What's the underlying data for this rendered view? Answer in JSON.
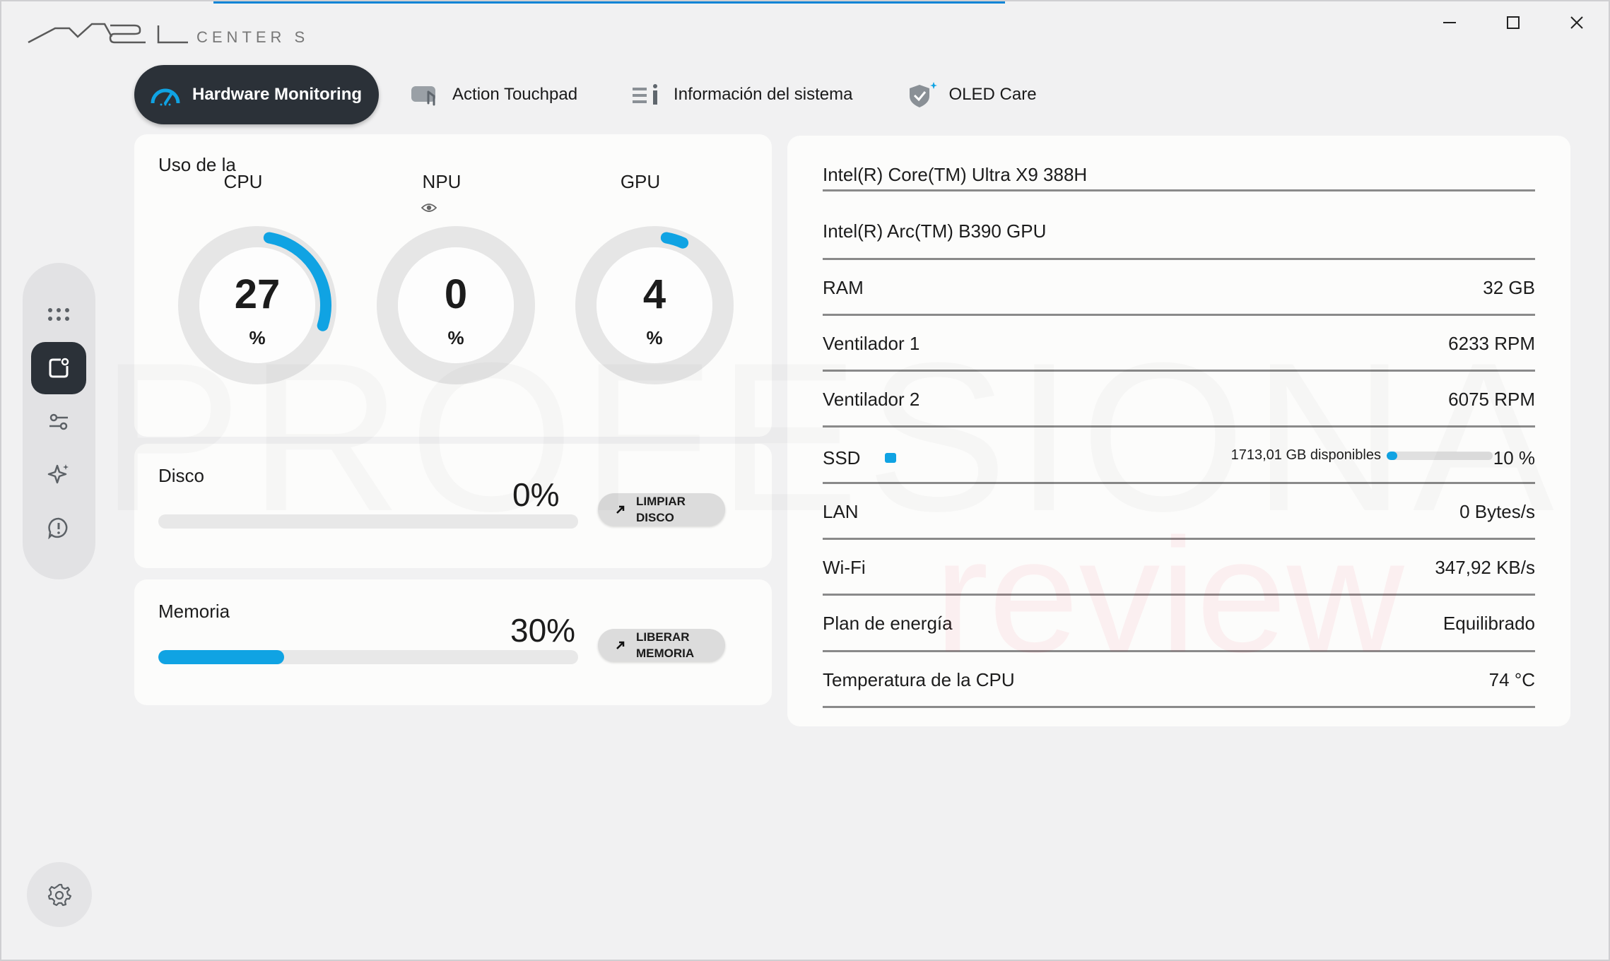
{
  "app": {
    "name": "MSI Center S",
    "accent": "#10a3e3",
    "dark": "#2b3138"
  },
  "window_controls": [
    "minimize-icon",
    "maximize-icon",
    "close-icon"
  ],
  "tabs": [
    {
      "label": "Hardware Monitoring",
      "icon": "speedometer-icon",
      "active": true
    },
    {
      "label": "Action Touchpad",
      "icon": "touchpad-icon",
      "active": false
    },
    {
      "label": "Información del sistema",
      "icon": "system-info-icon",
      "active": false
    },
    {
      "label": "OLED Care",
      "icon": "shield-sparkle-icon",
      "active": false
    }
  ],
  "sidebar": {
    "items": [
      {
        "icon": "apps-grid-icon",
        "active": false
      },
      {
        "icon": "feature-box-icon",
        "active": true
      },
      {
        "icon": "sliders-icon",
        "active": false
      },
      {
        "icon": "sparkle-star-icon",
        "active": false
      },
      {
        "icon": "support-chat-icon",
        "active": false
      }
    ],
    "settings_icon": "gear-icon"
  },
  "usage": {
    "title": "Uso de la",
    "gauges": [
      {
        "label": "CPU",
        "value": "27",
        "unit": "%",
        "fraction": 0.27
      },
      {
        "label": "NPU",
        "value": "0",
        "unit": "%",
        "fraction": 0
      },
      {
        "label": "GPU",
        "value": "4",
        "unit": "%",
        "fraction": 0.04
      }
    ]
  },
  "disk": {
    "title": "Disco",
    "percent_text": "0%",
    "fraction": 0,
    "button_label": "LIMPIAR\nDISCO"
  },
  "memory": {
    "title": "Memoria",
    "percent_text": "30%",
    "fraction": 0.3,
    "button_label": "LIBERAR\nMEMORIA"
  },
  "system": {
    "cpu_name": "Intel(R) Core(TM) Ultra X9 388H",
    "gpu_name": "Intel(R) Arc(TM) B390 GPU",
    "rows": [
      {
        "key": "RAM",
        "value": "32 GB"
      },
      {
        "key": "Ventilador 1",
        "value": "6233 RPM"
      },
      {
        "key": "Ventilador 2",
        "value": "6075 RPM"
      },
      {
        "key": "SSD",
        "value": "10 %",
        "free": "1713,01 GB disponibles",
        "fraction": 0.1
      },
      {
        "key": "LAN",
        "value": "0 Bytes/s"
      },
      {
        "key": "Wi-Fi",
        "value": "347,92 KB/s"
      },
      {
        "key": "Plan de energía",
        "value": "Equilibrado"
      },
      {
        "key": "Temperatura de la CPU",
        "value": "74 °C"
      }
    ]
  },
  "watermark": {
    "line1": "PROFESIONAL",
    "line2": "review"
  }
}
